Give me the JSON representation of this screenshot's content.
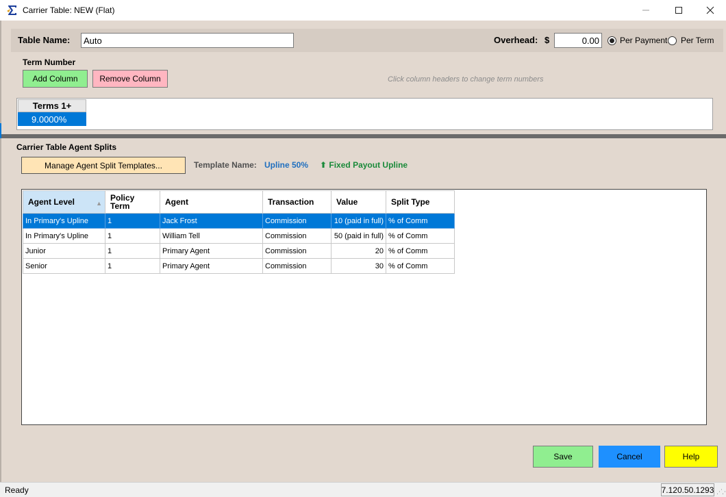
{
  "window": {
    "title": "Carrier Table: NEW (Flat)",
    "icon": "sigma-app-icon",
    "controls": {
      "minimize": "minimize-icon",
      "maximize": "maximize-icon",
      "close": "close-icon"
    }
  },
  "header": {
    "table_name_label": "Table Name:",
    "table_name_value": "Auto",
    "overhead_label": "Overhead:",
    "currency_symbol": "$",
    "overhead_value": "0.00",
    "per_payment_label": "Per Payment",
    "per_term_label": "Per Term",
    "selected_period": "Per Payment"
  },
  "term_number": {
    "title": "Term Number",
    "add_column_label": "Add Column",
    "remove_column_label": "Remove Column",
    "hint": "Click column headers to change term numbers",
    "columns": [
      {
        "header": "Terms 1+",
        "value": "9.0000%"
      }
    ]
  },
  "agent_splits": {
    "title": "Carrier Table Agent Splits",
    "manage_button_label": "Manage Agent Split Templates...",
    "template_name_label": "Template Name:",
    "template_name_value": "Upline 50%",
    "fixed_payout_label": "⬆ Fixed Payout Upline",
    "columns": {
      "agent_level": "Agent Level",
      "policy_term_line1": "Policy",
      "policy_term_line2": "Term",
      "agent": "Agent",
      "transaction": "Transaction",
      "value": "Value",
      "split_type": "Split Type"
    },
    "rows": [
      {
        "agent_level": "In Primary's Upline",
        "policy_term": "1",
        "agent": "Jack Frost",
        "transaction": "Commission",
        "value": "10 (paid in full)",
        "split_type": "% of Comm",
        "selected": true
      },
      {
        "agent_level": "In Primary's Upline",
        "policy_term": "1",
        "agent": "William Tell",
        "transaction": "Commission",
        "value": "50 (paid in full)",
        "split_type": "% of Comm",
        "selected": false
      },
      {
        "agent_level": "Junior",
        "policy_term": "1",
        "agent": "Primary Agent",
        "transaction": "Commission",
        "value": "20",
        "split_type": "% of Comm",
        "selected": false
      },
      {
        "agent_level": "Senior",
        "policy_term": "1",
        "agent": "Primary Agent",
        "transaction": "Commission",
        "value": "30",
        "split_type": "% of Comm",
        "selected": false
      }
    ]
  },
  "footer": {
    "save_label": "Save",
    "cancel_label": "Cancel",
    "help_label": "Help"
  },
  "status": {
    "text": "Ready",
    "version": "7.120.50.1293"
  },
  "colors": {
    "client_bg": "#e2d8cf",
    "selection": "#0078d7",
    "add_button": "#90ee90",
    "remove_button": "#ffb6c1",
    "manage_button": "#ffe4b5",
    "cancel_button": "#1e90ff",
    "help_button": "#ffff00",
    "template_name": "#1f6fbf",
    "fixed_payout": "#1a8a3a"
  }
}
